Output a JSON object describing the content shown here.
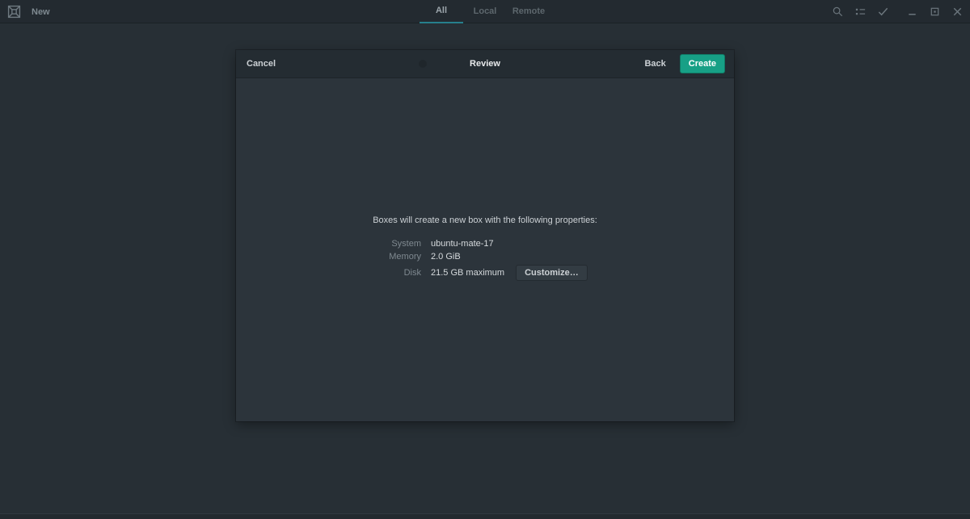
{
  "window": {
    "title": "New"
  },
  "topbar": {
    "tabs": [
      {
        "label": "All",
        "active": true
      },
      {
        "label": "Local",
        "active": false
      },
      {
        "label": "Remote",
        "active": false
      }
    ],
    "icons": [
      "search-icon",
      "list-view-icon",
      "select-mode-icon",
      "minimize-icon",
      "maximize-icon",
      "close-icon"
    ]
  },
  "dialog": {
    "cancel_label": "Cancel",
    "title": "Review",
    "back_label": "Back",
    "create_label": "Create",
    "message": "Boxes will create a new box with the following properties:",
    "properties": [
      {
        "label": "System",
        "value": "ubuntu-mate-17"
      },
      {
        "label": "Memory",
        "value": "2.0 GiB"
      },
      {
        "label": "Disk",
        "value": "21.5 GB maximum",
        "action": "Customize…"
      }
    ]
  },
  "colors": {
    "accent": "#17a086",
    "tab_underline": "#267f8c",
    "topbar_bg": "#232a30",
    "backdrop_bg": "#272f35",
    "dialog_bg": "#2c343b",
    "dialog_header_bg": "#242c32"
  }
}
